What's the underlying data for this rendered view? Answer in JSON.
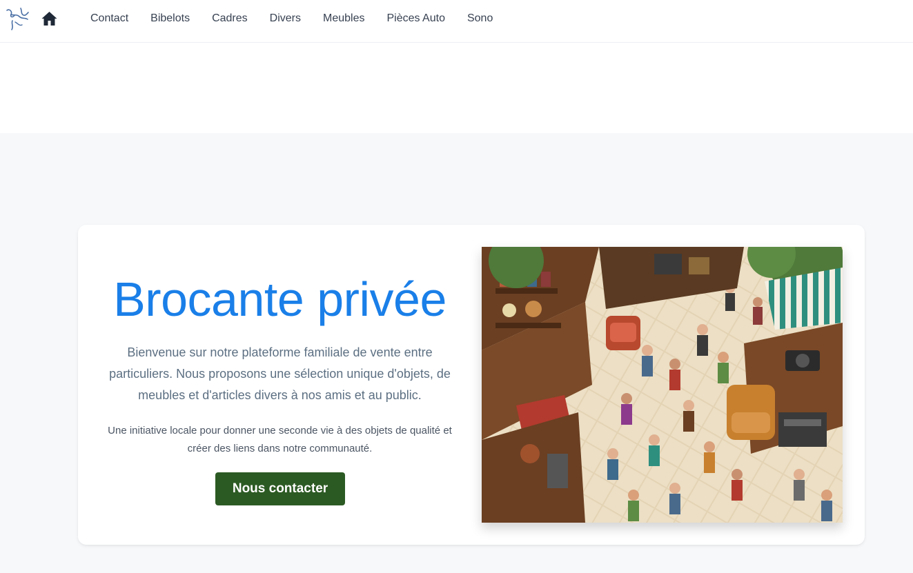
{
  "nav": {
    "links": [
      "Contact",
      "Bibelots",
      "Cadres",
      "Divers",
      "Meubles",
      "Pièces Auto",
      "Sono"
    ]
  },
  "hero": {
    "title": "Brocante privée",
    "description": "Bienvenue sur notre plateforme familiale de vente entre particuliers. Nous proposons une sélection unique d'objets, de meubles et d'articles divers à nos amis et au public.",
    "subtext": "Une initiative locale pour donner une seconde vie à des objets de qualité et créer des liens dans notre communauté.",
    "cta_label": "Nous contacter"
  },
  "colors": {
    "accent": "#1a7fe8",
    "cta": "#2c5a23",
    "background": "#f6f8fa"
  },
  "icons": [
    "logo-icon",
    "home-icon"
  ]
}
